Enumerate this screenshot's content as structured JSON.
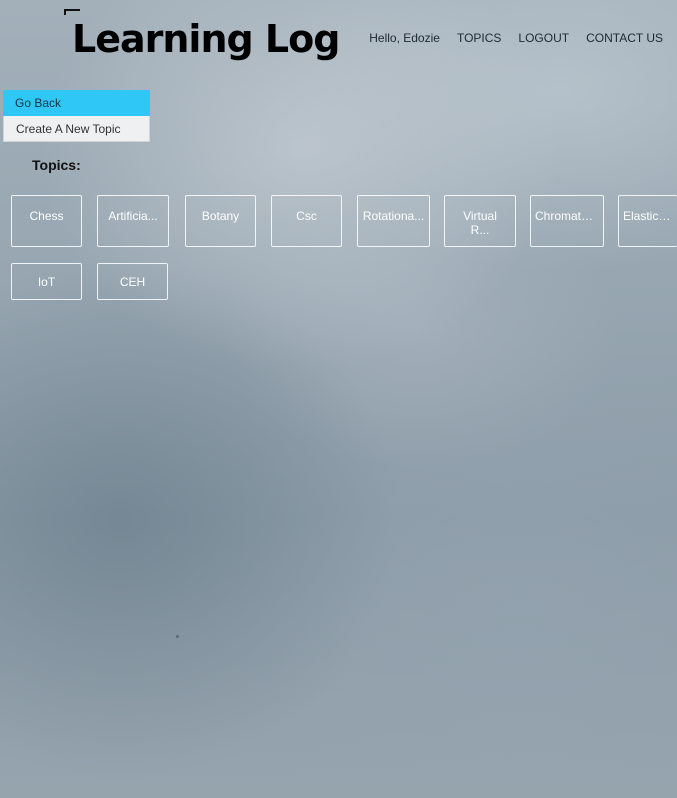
{
  "header": {
    "site_title": "Learning Log",
    "nav": {
      "greeting": "Hello, Edozie",
      "topics": "TOPICS",
      "logout": "LOGOUT",
      "contact": "CONTACT US"
    }
  },
  "sidebar": {
    "items": [
      {
        "label": "Go Back"
      },
      {
        "label": "Create A New Topic"
      }
    ]
  },
  "main": {
    "topics_heading": "Topics:",
    "topics": [
      {
        "label": "Chess"
      },
      {
        "label": "Artificia..."
      },
      {
        "label": "Botany"
      },
      {
        "label": "Csc"
      },
      {
        "label": "Rotationa..."
      },
      {
        "label": "Virtual R..."
      },
      {
        "label": "Chromatog..."
      },
      {
        "label": "Elasticit..."
      },
      {
        "label": "IoT"
      },
      {
        "label": "CEH"
      }
    ]
  },
  "colors": {
    "active_menu": "#2fc7f5",
    "card_border": "#ffffff"
  }
}
